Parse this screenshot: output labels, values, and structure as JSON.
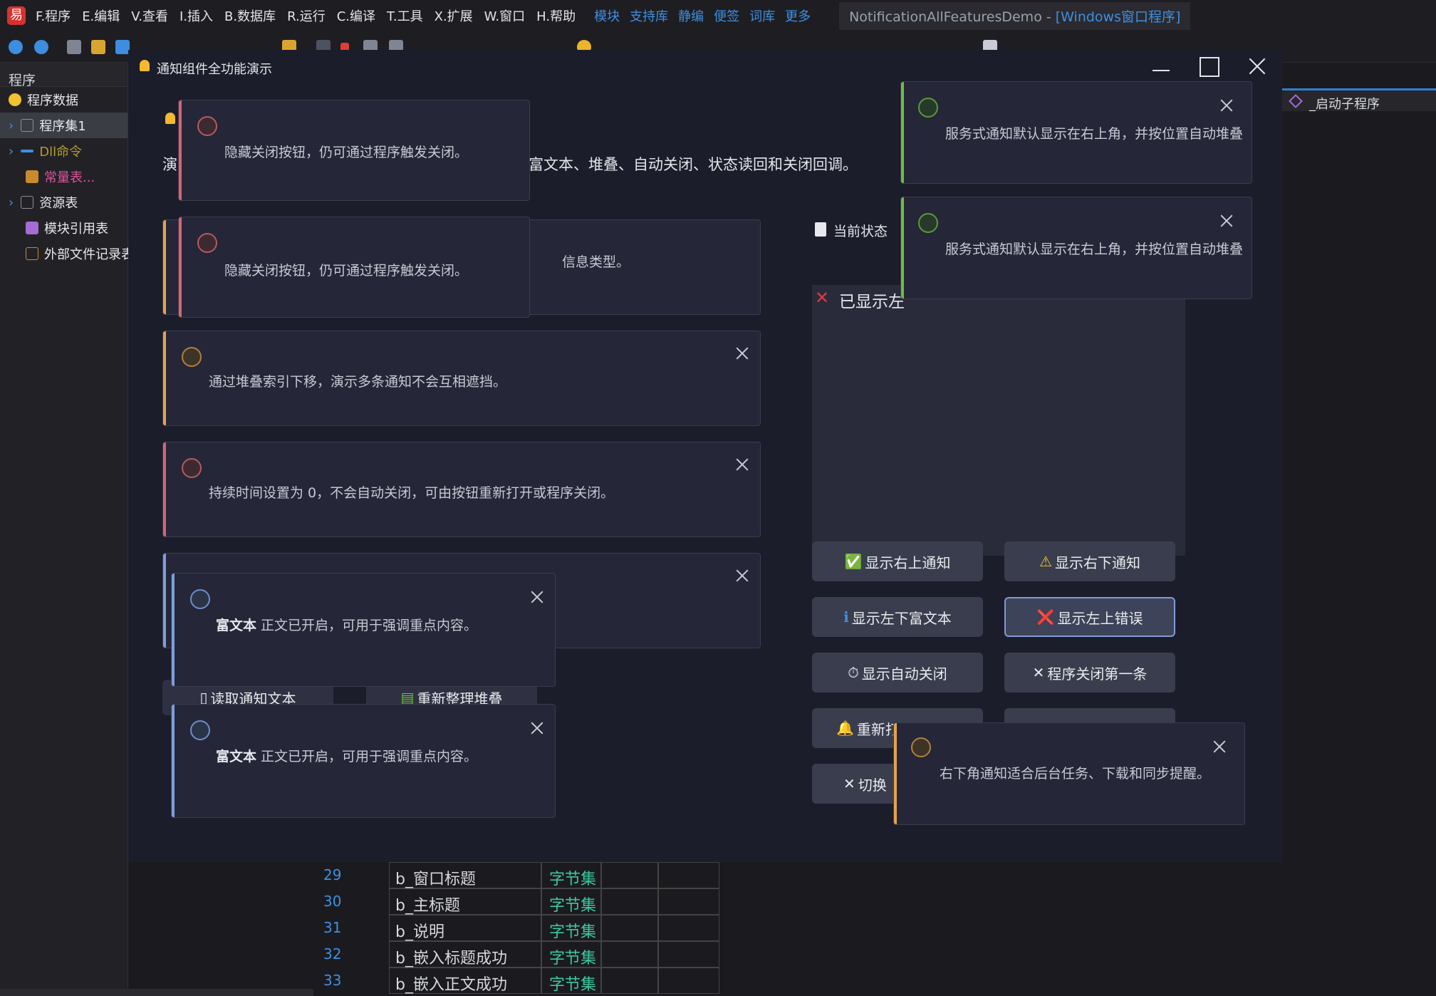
{
  "ide": {
    "menu": [
      "F.程序",
      "E.编辑",
      "V.查看",
      "I.插入",
      "B.数据库",
      "R.运行",
      "C.编译",
      "T.工具",
      "X.扩展",
      "W.窗口",
      "H.帮助"
    ],
    "links": [
      "模块",
      "支持库",
      "静编",
      "便签",
      "词库",
      "更多"
    ],
    "title_app": "NotificationAllFeaturesDemo - ",
    "title_kind": "[Windows窗口程序]",
    "panel_header": "程序",
    "tree": [
      {
        "label": "程序数据",
        "color": "#e6e8ee"
      },
      {
        "label": "程序集1",
        "color": "#e6e8ee"
      },
      {
        "label": "Dll命令",
        "color": "#b39c28"
      },
      {
        "label": "常量表...",
        "color": "#e0529f"
      },
      {
        "label": "资源表",
        "color": "#e6e8ee"
      },
      {
        "label": "模块引用表",
        "color": "#e6e8ee"
      },
      {
        "label": "外部文件记录表",
        "color": "#e6e8ee"
      }
    ],
    "right_tab": "_启动子程序",
    "code_rows": [
      {
        "ln": "29",
        "name": "b_窗口标题",
        "type": "字节集"
      },
      {
        "ln": "30",
        "name": "b_主标题",
        "type": "字节集"
      },
      {
        "ln": "31",
        "name": "b_说明",
        "type": "字节集"
      },
      {
        "ln": "32",
        "name": "b_嵌入标题成功",
        "type": "字节集"
      },
      {
        "ln": "33",
        "name": "b_嵌入正文成功",
        "type": "字节集"
      }
    ]
  },
  "window": {
    "title": "通知组件全功能演示",
    "intro_start": "演",
    "intro_end": "富文本、堆叠、自动关闭、状态读回和关闭回调。",
    "row1_tail": "信息类型。",
    "status_title": "当前状态",
    "status_text": "已显示左"
  },
  "cards": [
    {
      "msg": "通过堆叠索引下移，演示多条通知不会互相遮挡。"
    },
    {
      "msg": "持续时间设置为 0，不会自动关闭，可由按钮重新打开或程序关闭。"
    },
    {
      "msg": "隐藏关闭按钮，仍可通过程序触发关闭。"
    },
    {
      "msg": "隐藏关闭按钮，仍可通过程序触发关闭。"
    },
    {
      "bold": "富文本",
      "msg": " 正文已开启，可用于强调重点内容。"
    },
    {
      "bold": "富文本",
      "msg": " 正文已开启，可用于强调重点内容。"
    },
    {
      "msg": "服务式通知默认显示在右上角，并按位置自动堆叠"
    },
    {
      "msg": "服务式通知默认显示在右上角，并按位置自动堆叠"
    },
    {
      "msg": "右下角通知适合后台任务、下载和同步提醒。"
    }
  ],
  "bottom_buttons": [
    "读取通知文本",
    "重新整理堆叠"
  ],
  "buttons": [
    {
      "glyph": "✅",
      "label": "显示右上通知"
    },
    {
      "glyph": "⚠",
      "label": "显示右下通知"
    },
    {
      "glyph": "ℹ",
      "label": "显示左下富文本"
    },
    {
      "glyph": "❌",
      "label": "显示左上错误"
    },
    {
      "glyph": "⏱",
      "label": "显示自动关闭"
    },
    {
      "glyph": "✕",
      "label": "程序关闭第一条"
    },
    {
      "glyph": "🔔",
      "label": "重新打"
    },
    {
      "glyph": "✕",
      "label": "切换"
    }
  ],
  "colors": {
    "error": "#d9646f",
    "warning": "#e5a347",
    "success": "#6bbf3a",
    "info": "#7c9fdb"
  }
}
